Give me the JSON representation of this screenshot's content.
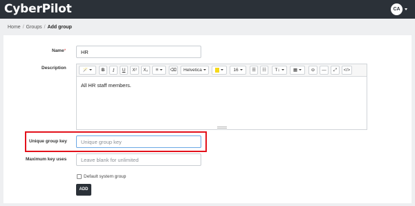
{
  "header": {
    "logo": "CyberPilot",
    "avatar_initials": "CA"
  },
  "breadcrumb": {
    "items": [
      "Home",
      "Groups"
    ],
    "current": "Add group",
    "separator": "/"
  },
  "form": {
    "name": {
      "label": "Name",
      "required_mark": "*",
      "value": "HR"
    },
    "description": {
      "label": "Description",
      "content": "All HR staff members.",
      "toolbar": {
        "magic": "🪄",
        "bold": "B",
        "italic": "I",
        "underline": "U",
        "superscript": "X²",
        "subscript": "X₂",
        "eraser": "⌫",
        "font_family": "Helvetica",
        "font_color": "A",
        "font_size": "16",
        "unordered_list": "☰",
        "ordered_list": "☷",
        "text_height": "T↕",
        "table": "▦",
        "link": "⊖",
        "hr": "—",
        "fullscreen": "⤢",
        "code": "</>"
      }
    },
    "unique_group_key": {
      "label": "Unique group key",
      "placeholder": "Unique group key",
      "value": ""
    },
    "max_key_uses": {
      "label": "Maximum key uses",
      "placeholder": "Leave blank for unlimited",
      "value": ""
    },
    "default_system_group": {
      "label": "Default system group",
      "checked": false
    },
    "submit_label": "ADD"
  },
  "colors": {
    "topbar": "#2b3138",
    "highlight": "#e3101a",
    "focus": "#6aa7e4"
  }
}
